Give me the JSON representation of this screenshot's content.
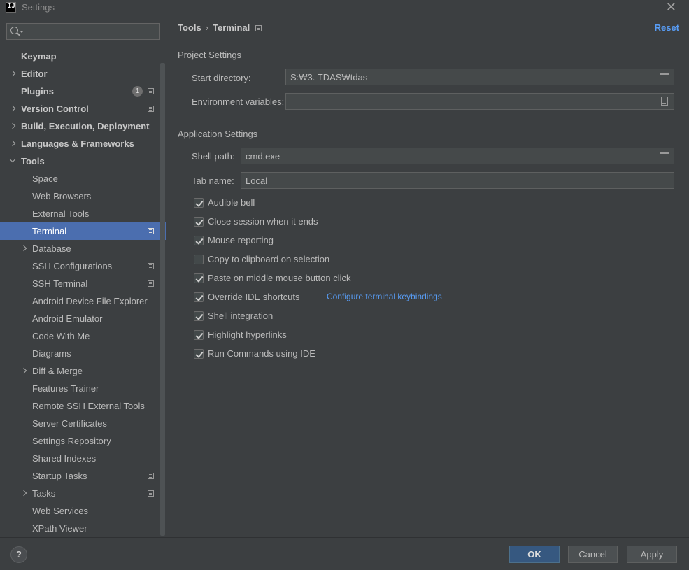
{
  "window": {
    "title": "Settings",
    "app_icon_text": "IJ"
  },
  "search": {
    "placeholder": ""
  },
  "sidebar": {
    "items": [
      {
        "label": "Keymap"
      },
      {
        "label": "Editor"
      },
      {
        "label": "Plugins",
        "badge": "1"
      },
      {
        "label": "Version Control"
      },
      {
        "label": "Build, Execution, Deployment"
      },
      {
        "label": "Languages & Frameworks"
      },
      {
        "label": "Tools"
      }
    ],
    "tools_children": [
      {
        "label": "Space"
      },
      {
        "label": "Web Browsers"
      },
      {
        "label": "External Tools"
      },
      {
        "label": "Terminal"
      },
      {
        "label": "Database"
      },
      {
        "label": "SSH Configurations"
      },
      {
        "label": "SSH Terminal"
      },
      {
        "label": "Android Device File Explorer"
      },
      {
        "label": "Android Emulator"
      },
      {
        "label": "Code With Me"
      },
      {
        "label": "Diagrams"
      },
      {
        "label": "Diff & Merge"
      },
      {
        "label": "Features Trainer"
      },
      {
        "label": "Remote SSH External Tools"
      },
      {
        "label": "Server Certificates"
      },
      {
        "label": "Settings Repository"
      },
      {
        "label": "Shared Indexes"
      },
      {
        "label": "Startup Tasks"
      },
      {
        "label": "Tasks"
      },
      {
        "label": "Web Services"
      },
      {
        "label": "XPath Viewer"
      }
    ]
  },
  "header": {
    "crumb_parent": "Tools",
    "crumb_separator": "›",
    "crumb_current": "Terminal",
    "reset_label": "Reset"
  },
  "project_settings": {
    "title": "Project Settings",
    "start_directory_label": "Start directory:",
    "start_directory_value": "S:₩3. TDAS₩tdas",
    "env_vars_label": "Environment variables:",
    "env_vars_value": ""
  },
  "application_settings": {
    "title": "Application Settings",
    "shell_path_label": "Shell path:",
    "shell_path_value": "cmd.exe",
    "tab_name_label": "Tab name:",
    "tab_name_value": "Local",
    "checkboxes": [
      {
        "label": "Audible bell",
        "checked": true
      },
      {
        "label": "Close session when it ends",
        "checked": true
      },
      {
        "label": "Mouse reporting",
        "checked": true
      },
      {
        "label": "Copy to clipboard on selection",
        "checked": false
      },
      {
        "label": "Paste on middle mouse button click",
        "checked": true
      },
      {
        "label": "Override IDE shortcuts",
        "checked": true
      },
      {
        "label": "Shell integration",
        "checked": true
      },
      {
        "label": "Highlight hyperlinks",
        "checked": true
      },
      {
        "label": "Run Commands using IDE",
        "checked": true
      }
    ],
    "configure_keybindings_link": "Configure terminal keybindings"
  },
  "footer": {
    "help_label": "?",
    "ok_label": "OK",
    "cancel_label": "Cancel",
    "apply_label": "Apply"
  },
  "colors": {
    "background": "#3c3f41",
    "selection": "#4b6eaf",
    "link": "#589df6",
    "primary_button": "#365880"
  }
}
